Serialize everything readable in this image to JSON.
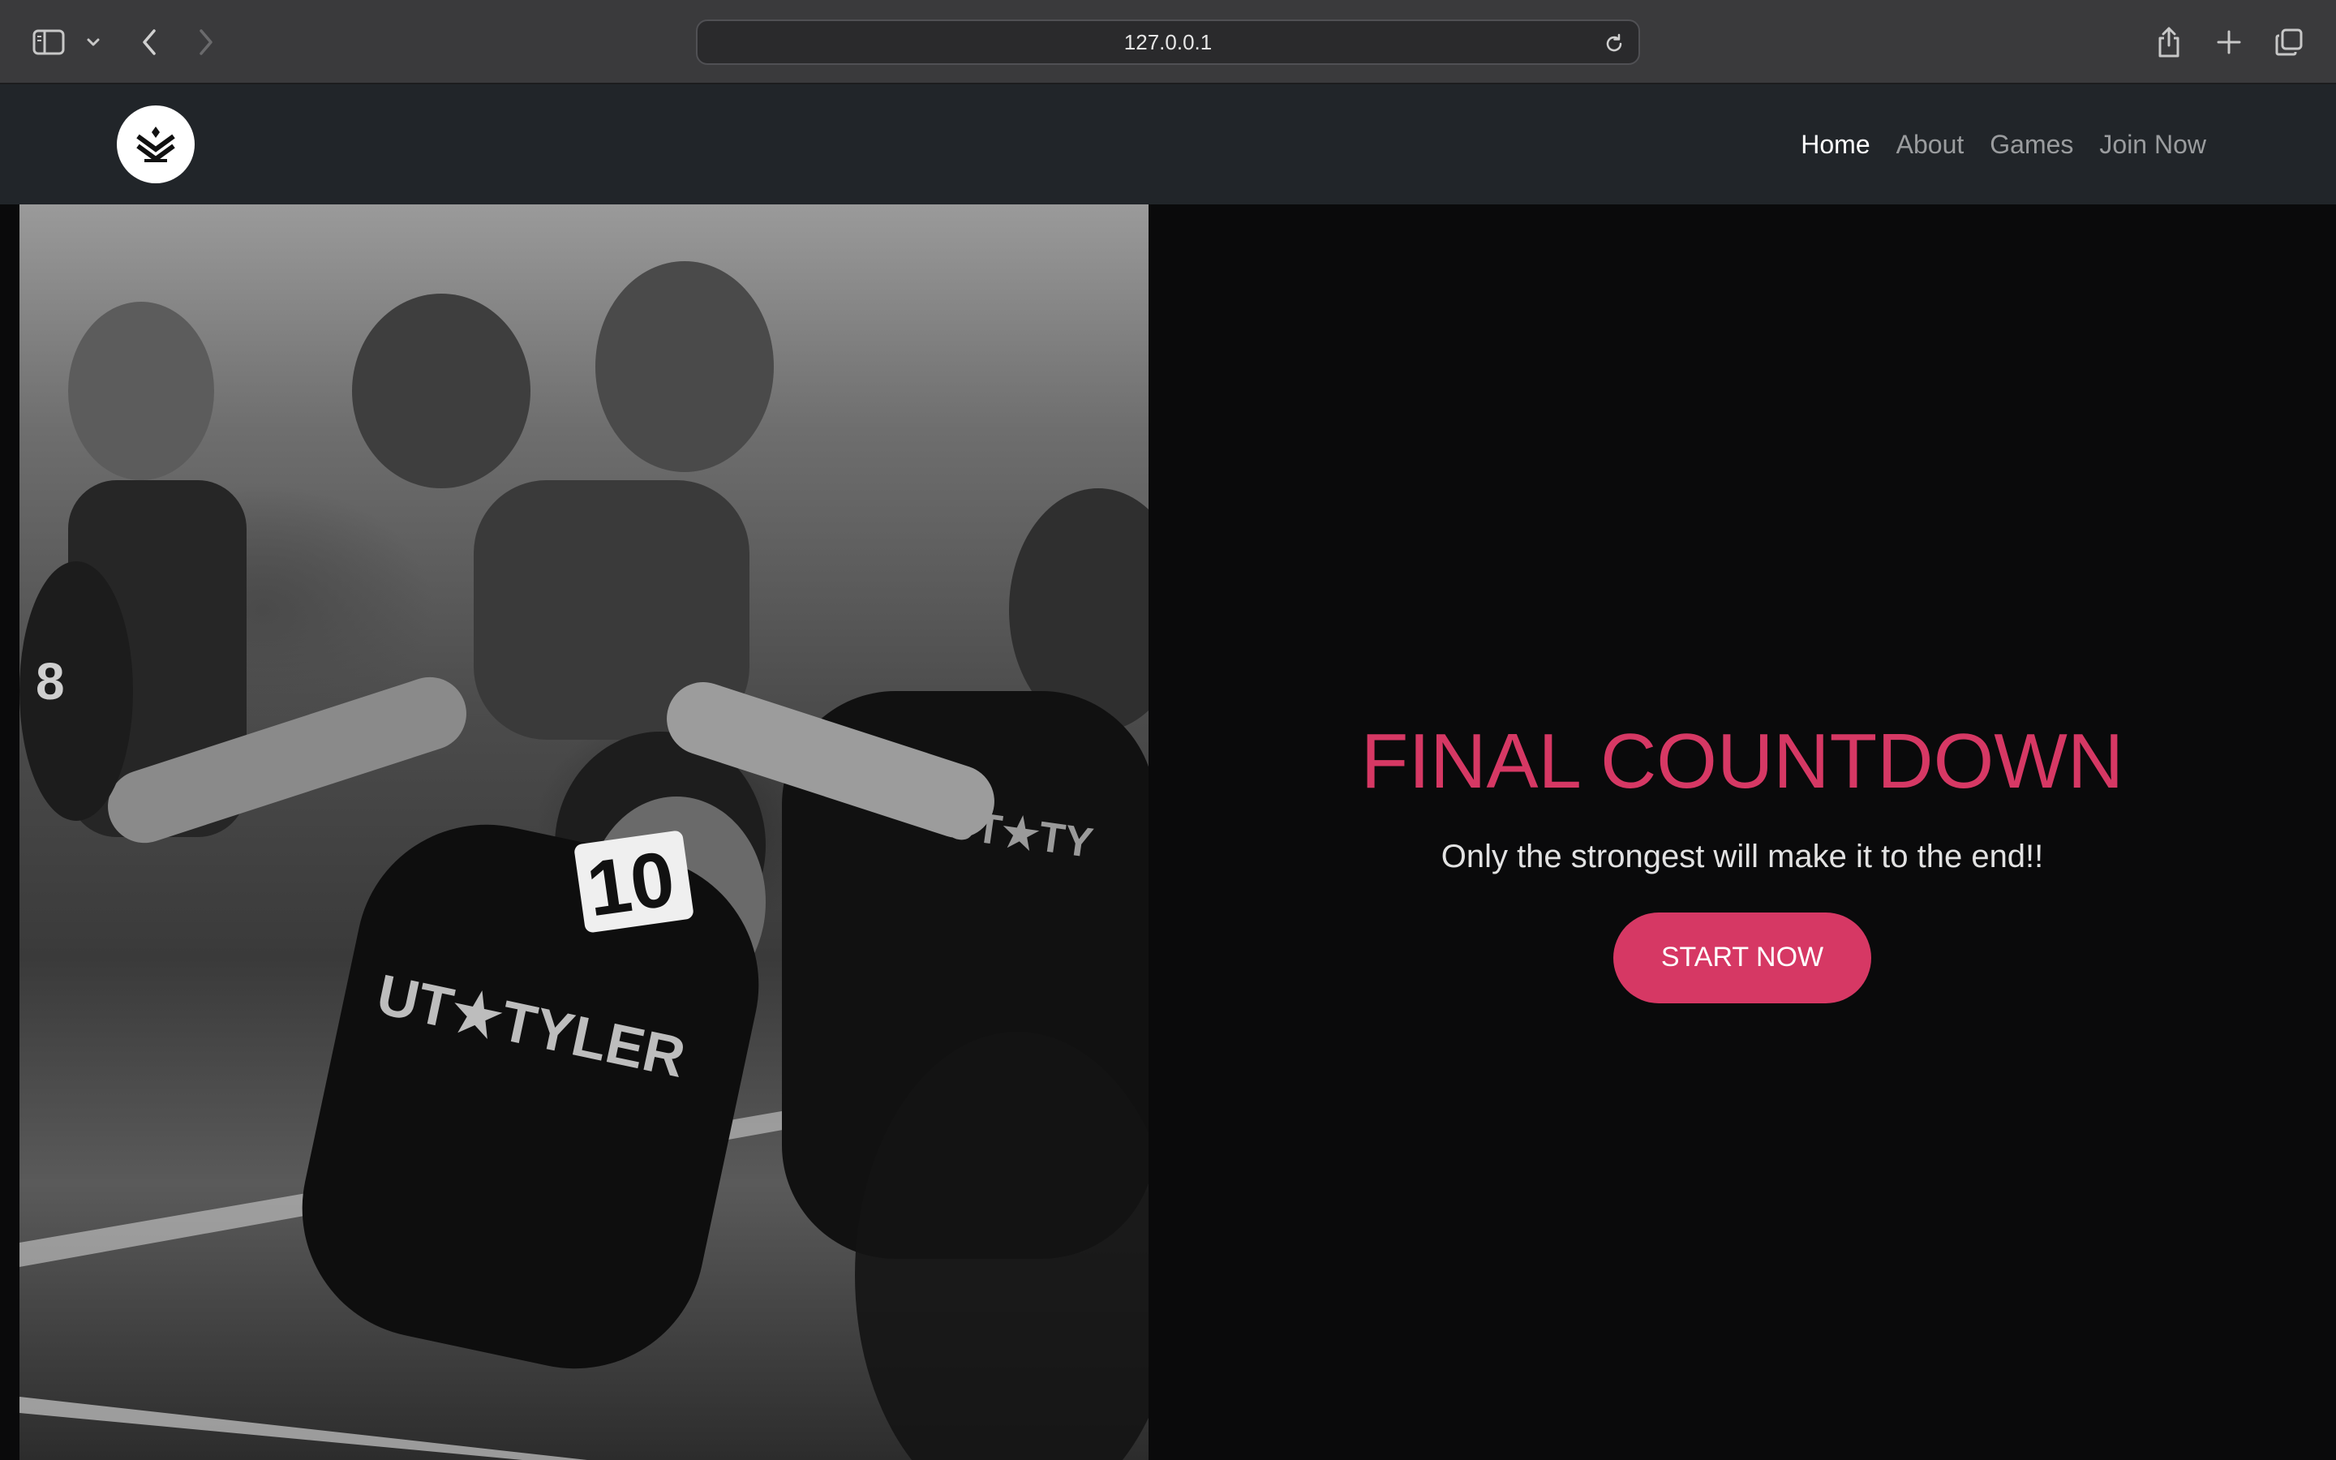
{
  "browser": {
    "url": "127.0.0.1",
    "icons": [
      "sidebar-icon",
      "chevron-down-icon",
      "back-icon",
      "forward-icon",
      "reload-icon",
      "share-icon",
      "new-tab-icon",
      "tabs-overview-icon"
    ]
  },
  "navbar": {
    "logo_icon": "chevron-badge-icon",
    "links": [
      {
        "label": "Home",
        "active": true
      },
      {
        "label": "About",
        "active": false
      },
      {
        "label": "Games",
        "active": false
      },
      {
        "label": "Join Now",
        "active": false
      }
    ]
  },
  "hero": {
    "title": "FINAL COUNTDOWN",
    "subtitle": "Only the strongest will make it to the end!!",
    "cta_label": "START NOW",
    "image_alt": "Black and white photo of runners starting a race"
  },
  "colors": {
    "accent": "#d63864",
    "navbar_bg": "#212529",
    "page_bg": "#0a0a0b",
    "chrome_bg": "#3a3a3c"
  }
}
